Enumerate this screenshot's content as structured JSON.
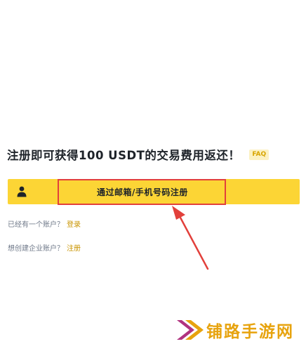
{
  "promo": {
    "headline": "注册即可获得100 USDT的交易费用返还！",
    "faq_label": "FAQ"
  },
  "register": {
    "button_label": "通过邮箱/手机号码注册",
    "icon": "user-icon"
  },
  "account": {
    "has_account_text": "已经有一个账户？",
    "login_link": "登录",
    "corporate_text": "想创建企业账户？",
    "register_link": "注册"
  },
  "watermark": {
    "text": "铺路手游网"
  },
  "colors": {
    "brand_yellow": "#fcd535",
    "highlight_red": "#e2403b",
    "link_gold": "#c99400",
    "faq_bg": "#fcf1c2",
    "watermark_orange": "#e7a30e",
    "watermark_purple": "#b0337f"
  }
}
